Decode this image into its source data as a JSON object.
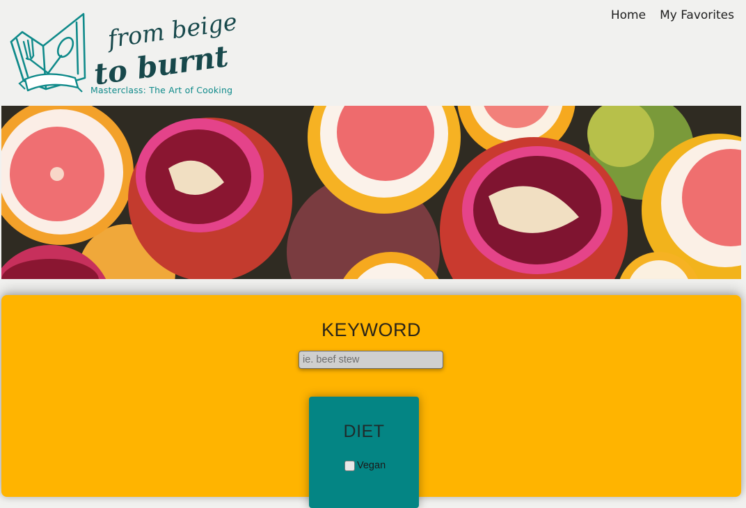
{
  "brand": {
    "script_line1": "from beige",
    "script_line2": "to burnt",
    "tagline": "Masterclass: The Art of Cooking",
    "accent_color": "#0f8a8a"
  },
  "nav": {
    "items": [
      {
        "label": "Home"
      },
      {
        "label": "My Favorites"
      }
    ]
  },
  "hero": {
    "icon": "fruit-photo"
  },
  "search": {
    "keyword_title": "KEYWORD",
    "keyword_placeholder": "ie. beef stew",
    "keyword_value": "",
    "panel_color": "#ffb400"
  },
  "diet": {
    "title": "DIET",
    "card_color": "#048584",
    "options": [
      {
        "label": "Vegan",
        "checked": false
      }
    ]
  }
}
